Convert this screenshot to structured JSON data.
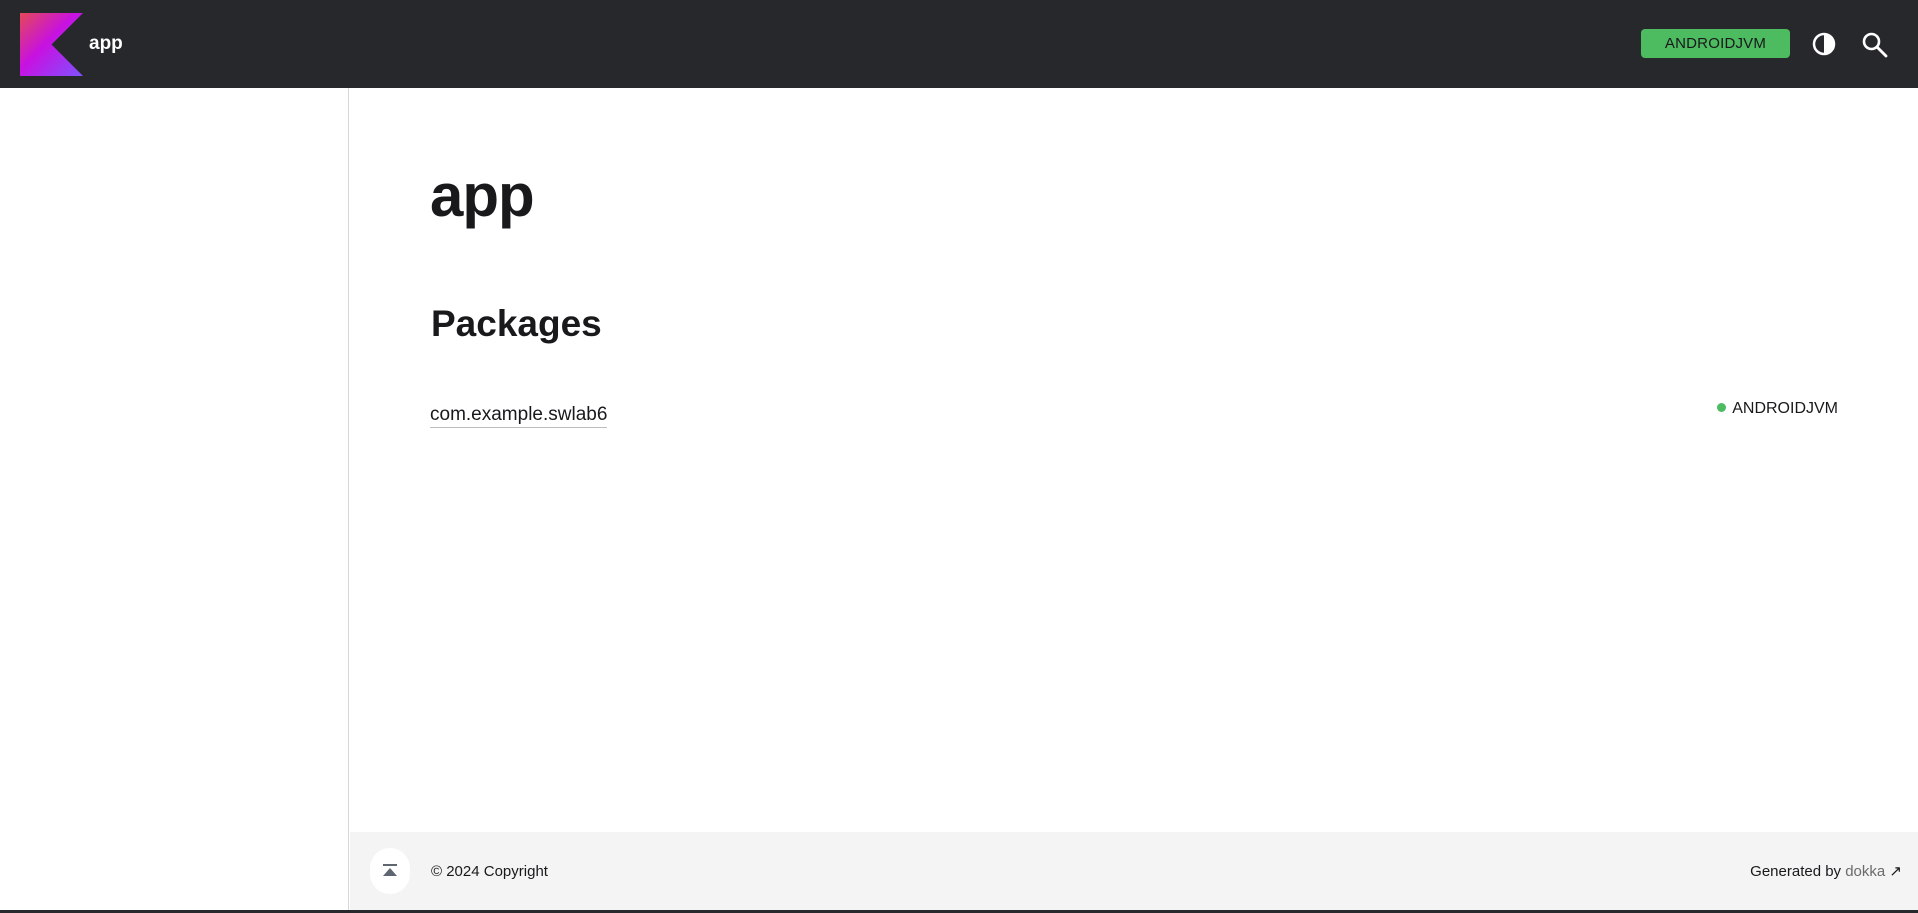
{
  "header": {
    "app_name": "app",
    "platform_button_label": "ANDROIDJVM",
    "logo_icon": "kotlin-logo",
    "theme_icon": "half-circle-contrast-icon",
    "search_icon": "magnifier-icon"
  },
  "main": {
    "title": "app",
    "section_title": "Packages",
    "packages": [
      {
        "name": "com.example.swlab6",
        "platform": "ANDROIDJVM"
      }
    ]
  },
  "footer": {
    "copyright": "© 2024 Copyright",
    "generated_by_prefix": "Generated by ",
    "generator_link": "dokka",
    "external_link_glyph": "↗",
    "scroll_top_icon": "scroll-to-top-icon"
  },
  "colors": {
    "header_bg": "#27282c",
    "platform_green": "#4dbb5f",
    "footer_bg": "#f4f4f4"
  }
}
